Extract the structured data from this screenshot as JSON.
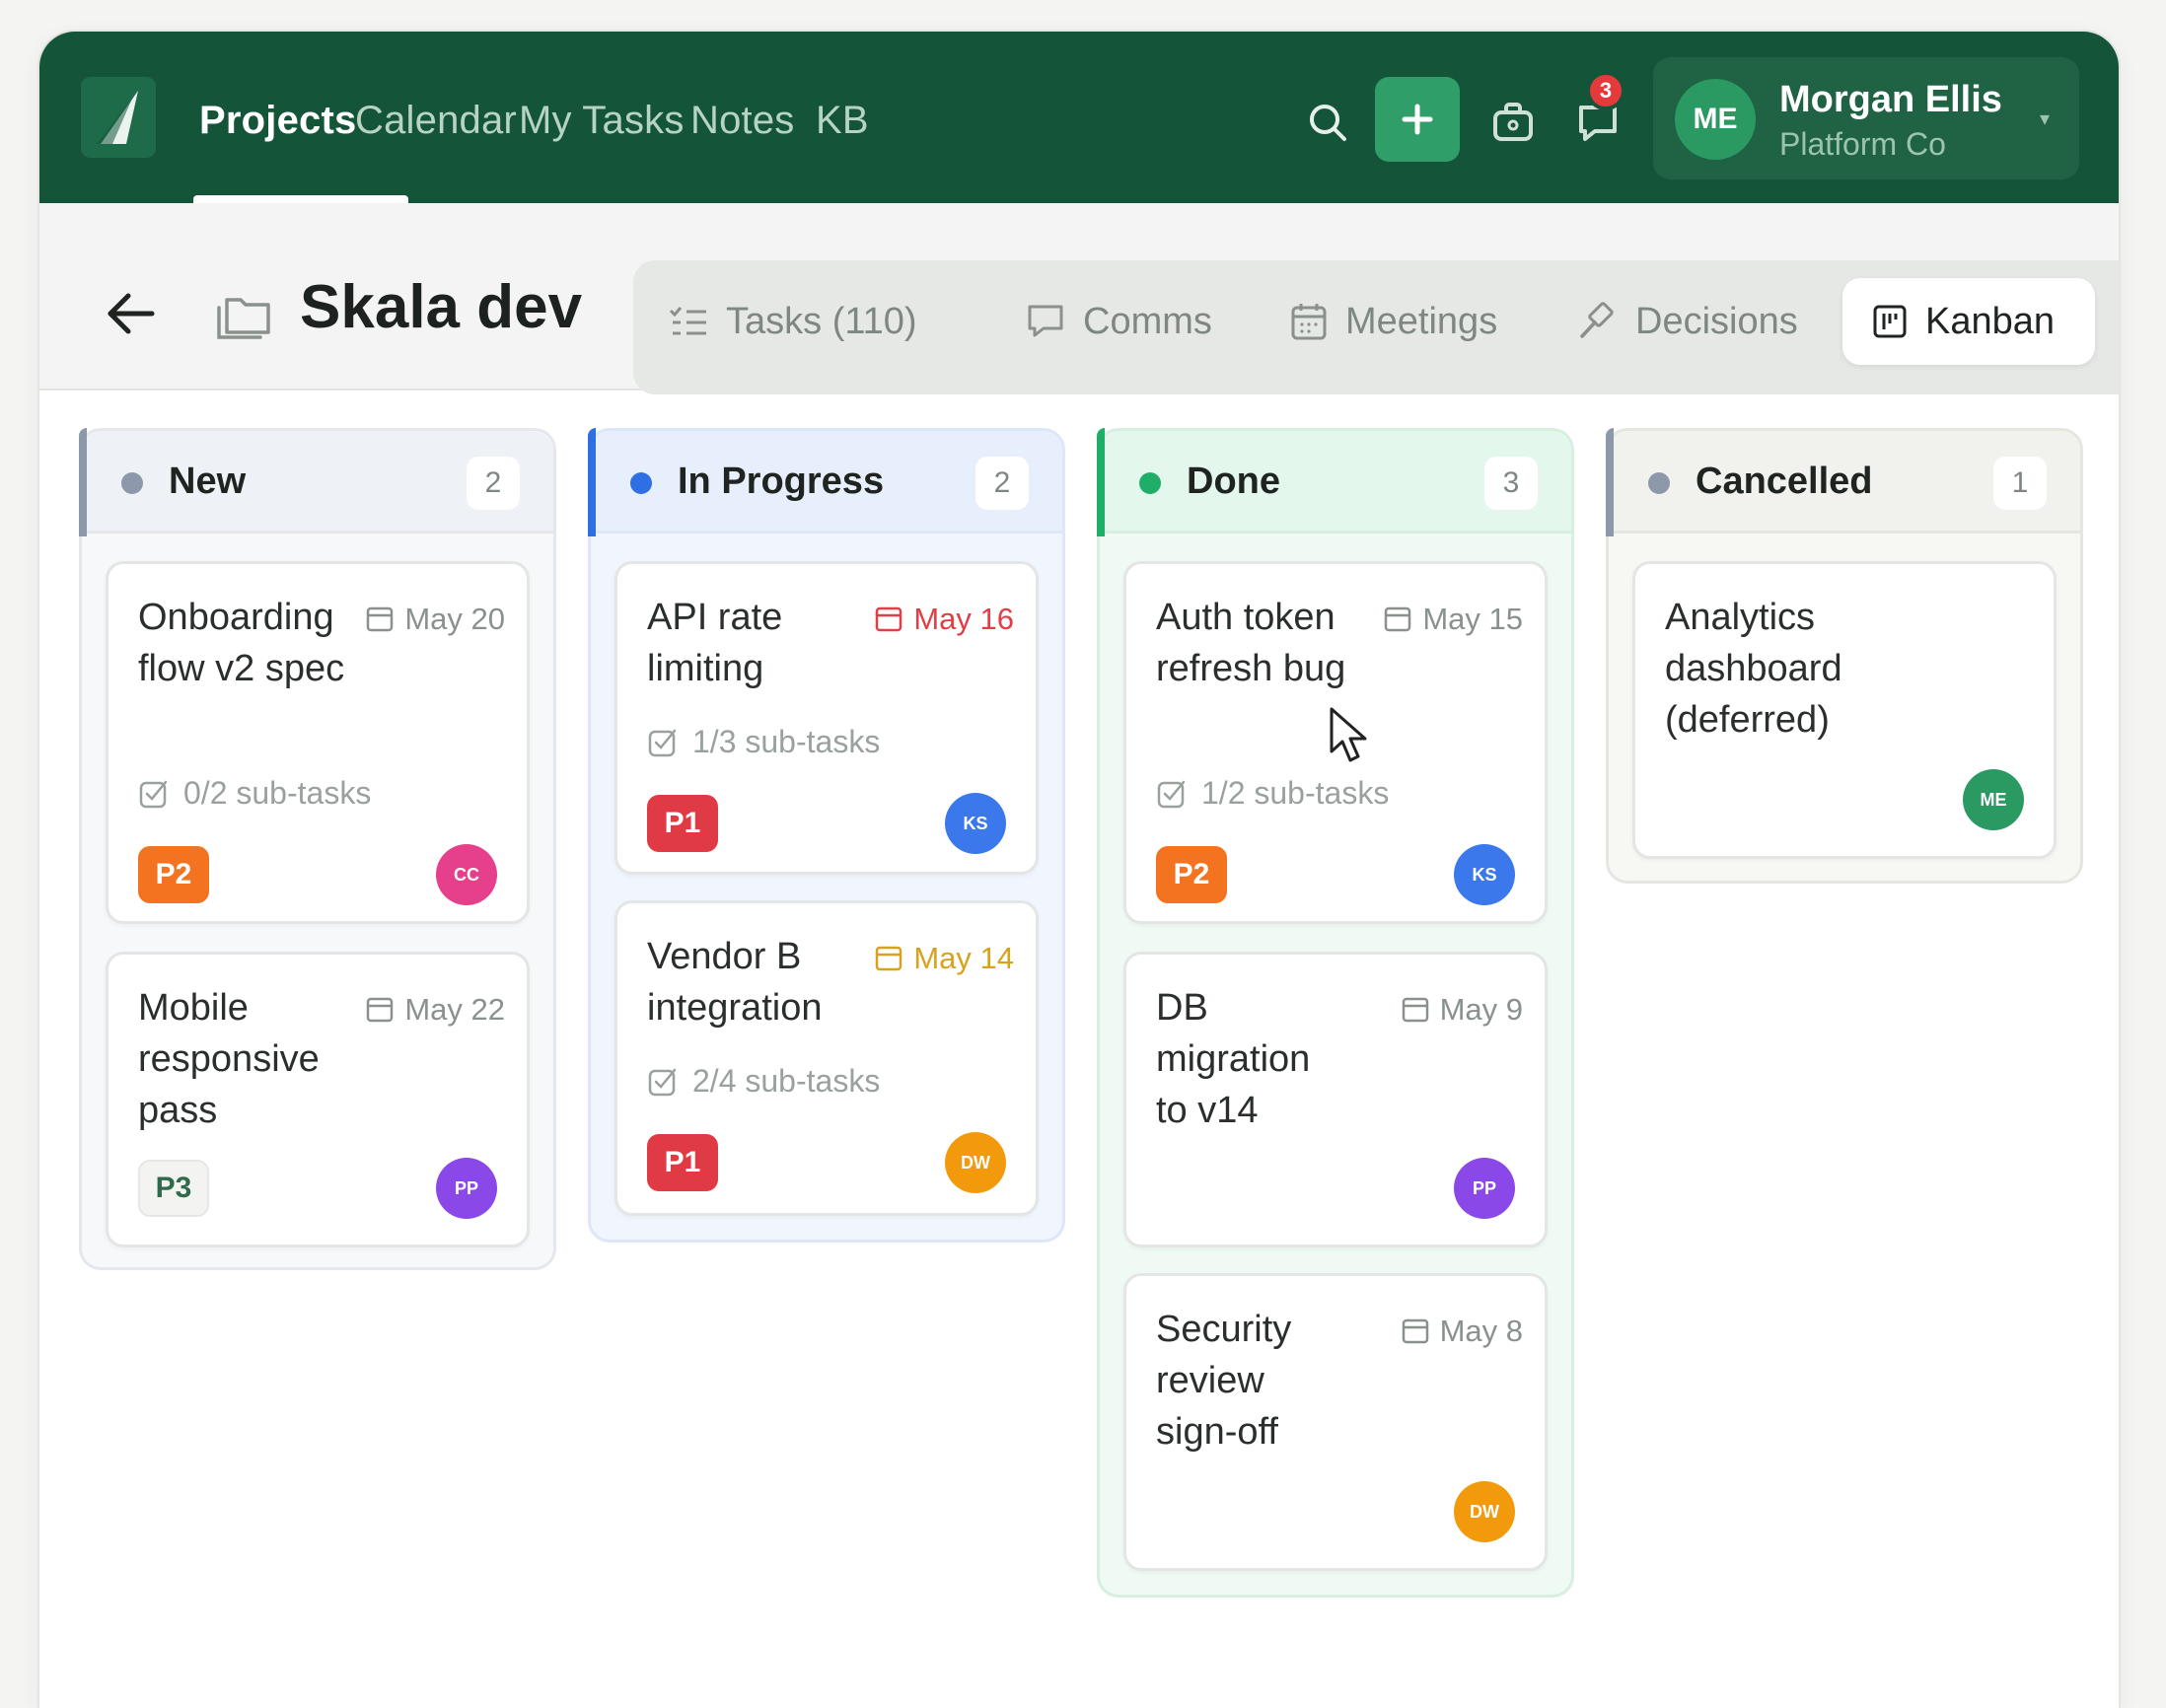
{
  "topbar": {
    "logo_icon": "sail-logo-icon",
    "nav": [
      "Projects",
      "Calendar",
      "My Tasks",
      "Notes",
      "KB"
    ],
    "active_nav": "Projects",
    "notifications_count": "3",
    "user": {
      "initials": "ME",
      "name": "Morgan Ellis",
      "org": "Platform Co"
    }
  },
  "subheader": {
    "title": "Skala dev",
    "tabs": [
      "Tasks (110)",
      "Comms",
      "Meetings",
      "Decisions",
      "Kanban"
    ],
    "active_tab": "Kanban"
  },
  "board": {
    "columns": [
      {
        "title": "New",
        "count": "2",
        "dot": "#8d98aa",
        "accent": "#8d98aa",
        "cards": [
          {
            "title": "Onboarding flow v2 spec",
            "date": "May 20",
            "subtasks": "0/2 sub-tasks",
            "priority": "P2",
            "assignee": "CC",
            "assignee_color": "#e63f8c"
          },
          {
            "title": "Mobile responsive pass",
            "date": "May 22",
            "subtasks": "",
            "priority": "P3",
            "assignee": "PP",
            "assignee_color": "#8b48e8"
          }
        ]
      },
      {
        "title": "In Progress",
        "count": "2",
        "dot": "#2f6fe4",
        "accent": "#2f6fe4",
        "cards": [
          {
            "title": "API rate limiting",
            "date": "May 16",
            "date_state": "overdue",
            "subtasks": "1/3 sub-tasks",
            "priority": "P1",
            "assignee": "KS",
            "assignee_color": "#3a78eb"
          },
          {
            "title": "Vendor B integration",
            "date": "May 14",
            "date_state": "soon",
            "subtasks": "2/4 sub-tasks",
            "priority": "P1",
            "assignee": "DW",
            "assignee_color": "#f29a0c"
          }
        ]
      },
      {
        "title": "Done",
        "count": "3",
        "dot": "#1fae67",
        "accent": "#1fae67",
        "cards": [
          {
            "title": "Auth token refresh bug",
            "date": "May 15",
            "subtasks": "1/2 sub-tasks",
            "priority": "P2",
            "assignee": "KS",
            "assignee_color": "#3a78eb"
          },
          {
            "title": "DB migration to v14",
            "date": "May 9",
            "subtasks": "",
            "priority": "",
            "assignee": "PP",
            "assignee_color": "#8b48e8"
          },
          {
            "title": "Security review sign-off",
            "date": "May 8",
            "subtasks": "",
            "priority": "",
            "assignee": "DW",
            "assignee_color": "#f29a0c"
          }
        ]
      },
      {
        "title": "Cancelled",
        "count": "1",
        "dot": "#8d98aa",
        "accent": "#8d98aa",
        "cards": [
          {
            "title": "Analytics dashboard (deferred)",
            "date": "",
            "subtasks": "",
            "priority": "",
            "assignee": "ME",
            "assignee_color": "#2a9a62"
          }
        ]
      }
    ]
  }
}
